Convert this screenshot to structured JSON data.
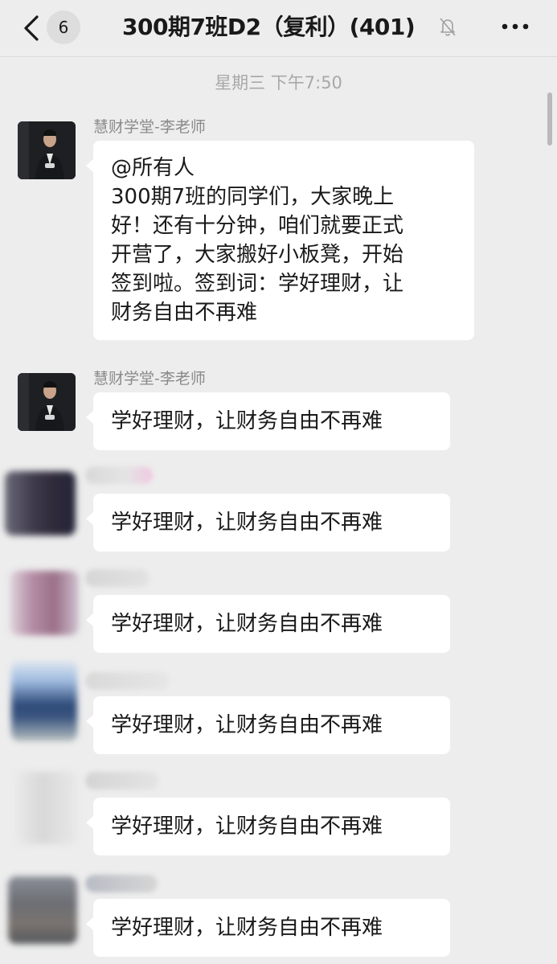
{
  "header": {
    "back_icon": "chevron-left-icon",
    "unread_count": "6",
    "title": "300期7班D2（复利）(401)",
    "mute_icon": "bell-muted-icon",
    "more_icon": "more-dots-icon"
  },
  "timestamp": "星期三 下午7:50",
  "messages": [
    {
      "sender": "慧财学堂-李老师",
      "lines": [
        "@所有人",
        "300期7班的同学们，大家晚上",
        "好！还有十分钟，咱们就要正式",
        "开营了，大家搬好小板凳，开始",
        "签到啦。签到词：学好理财，让",
        "财务自由不再难"
      ]
    },
    {
      "sender": "慧财学堂-李老师",
      "text": "学好理财，让财务自由不再难"
    },
    {
      "sender": "",
      "text": "学好理财，让财务自由不再难"
    },
    {
      "sender": "",
      "text": "学好理财，让财务自由不再难"
    },
    {
      "sender": "",
      "text": "学好理财，让财务自由不再难"
    },
    {
      "sender": "",
      "text": "学好理财，让财务自由不再难"
    },
    {
      "sender": "",
      "text": "学好理财，让财务自由不再难"
    }
  ],
  "colors": {
    "background": "#ededed",
    "bubble": "#ffffff",
    "timestamp": "#a8a8a8",
    "sender": "#8a8a8a"
  }
}
